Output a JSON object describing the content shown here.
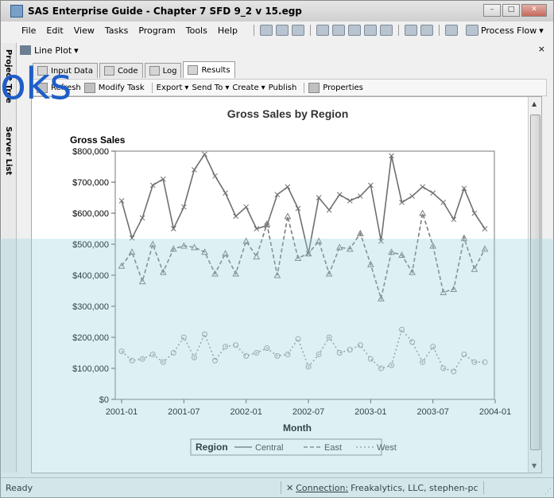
{
  "window": {
    "title": "SAS Enterprise Guide - Chapter 7 SFD 9_2 v 15.egp",
    "min": "–",
    "max": "□",
    "close": "✕"
  },
  "menu": {
    "items": [
      "File",
      "Edit",
      "View",
      "Tasks",
      "Program",
      "Tools",
      "Help"
    ],
    "process_flow": "Process Flow"
  },
  "sidebar": {
    "project_tree": "Project Tree",
    "server_list": "Server List"
  },
  "panel": {
    "title": "Line Plot",
    "dropdown": "▾",
    "close": "×"
  },
  "tabs": [
    "Input Data",
    "Code",
    "Log",
    "Results"
  ],
  "commands": {
    "refresh": "Refresh",
    "modify_task": "Modify Task",
    "export": "Export",
    "send_to": "Send To",
    "create": "Create",
    "publish": "Publish",
    "properties": "Properties"
  },
  "status": {
    "ready": "Ready",
    "connection_label": "Connection:",
    "connection_value": "Freakalytics, LLC, stephen-pc"
  },
  "watermark": {
    "text": "oks",
    "brand": "DropBooks"
  },
  "chart_data": {
    "type": "line",
    "title": "Gross Sales by Region",
    "ylabel": "Gross Sales",
    "xlabel": "Month",
    "ylim": [
      0,
      800000
    ],
    "yticks": [
      "$0",
      "$100,000",
      "$200,000",
      "$300,000",
      "$400,000",
      "$500,000",
      "$600,000",
      "$700,000",
      "$800,000"
    ],
    "xticks": [
      "2001-01",
      "2001-07",
      "2002-01",
      "2002-07",
      "2003-01",
      "2003-07",
      "2004-01"
    ],
    "x": [
      "2001-01",
      "2001-02",
      "2001-03",
      "2001-04",
      "2001-05",
      "2001-06",
      "2001-07",
      "2001-08",
      "2001-09",
      "2001-10",
      "2001-11",
      "2001-12",
      "2002-01",
      "2002-02",
      "2002-03",
      "2002-04",
      "2002-05",
      "2002-06",
      "2002-07",
      "2002-08",
      "2002-09",
      "2002-10",
      "2002-11",
      "2002-12",
      "2003-01",
      "2003-02",
      "2003-03",
      "2003-04",
      "2003-05",
      "2003-06",
      "2003-07",
      "2003-08",
      "2003-09",
      "2003-10",
      "2003-11",
      "2003-12"
    ],
    "legend_title": "Region",
    "legend_position": "bottom",
    "series": [
      {
        "name": "Central",
        "color": "#6f6f6f",
        "values": [
          640000,
          520000,
          585000,
          690000,
          710000,
          550000,
          620000,
          740000,
          790000,
          720000,
          665000,
          590000,
          620000,
          550000,
          560000,
          660000,
          685000,
          615000,
          470000,
          650000,
          610000,
          660000,
          640000,
          655000,
          690000,
          510000,
          785000,
          635000,
          655000,
          685000,
          665000,
          635000,
          580000,
          680000,
          600000,
          550000
        ]
      },
      {
        "name": "East",
        "color": "#7a7a7a",
        "values": [
          430000,
          475000,
          380000,
          500000,
          410000,
          485000,
          495000,
          490000,
          475000,
          405000,
          470000,
          405000,
          510000,
          460000,
          565000,
          400000,
          590000,
          455000,
          470000,
          510000,
          405000,
          490000,
          485000,
          535000,
          435000,
          325000,
          475000,
          465000,
          410000,
          600000,
          495000,
          345000,
          355000,
          520000,
          420000,
          485000
        ]
      },
      {
        "name": "West",
        "color": "#9a9a9a",
        "values": [
          155000,
          125000,
          130000,
          145000,
          120000,
          150000,
          200000,
          135000,
          210000,
          125000,
          170000,
          175000,
          140000,
          150000,
          165000,
          140000,
          145000,
          195000,
          105000,
          145000,
          200000,
          150000,
          160000,
          175000,
          130000,
          100000,
          110000,
          225000,
          185000,
          120000,
          170000,
          100000,
          90000,
          145000,
          120000,
          120000
        ]
      }
    ]
  }
}
